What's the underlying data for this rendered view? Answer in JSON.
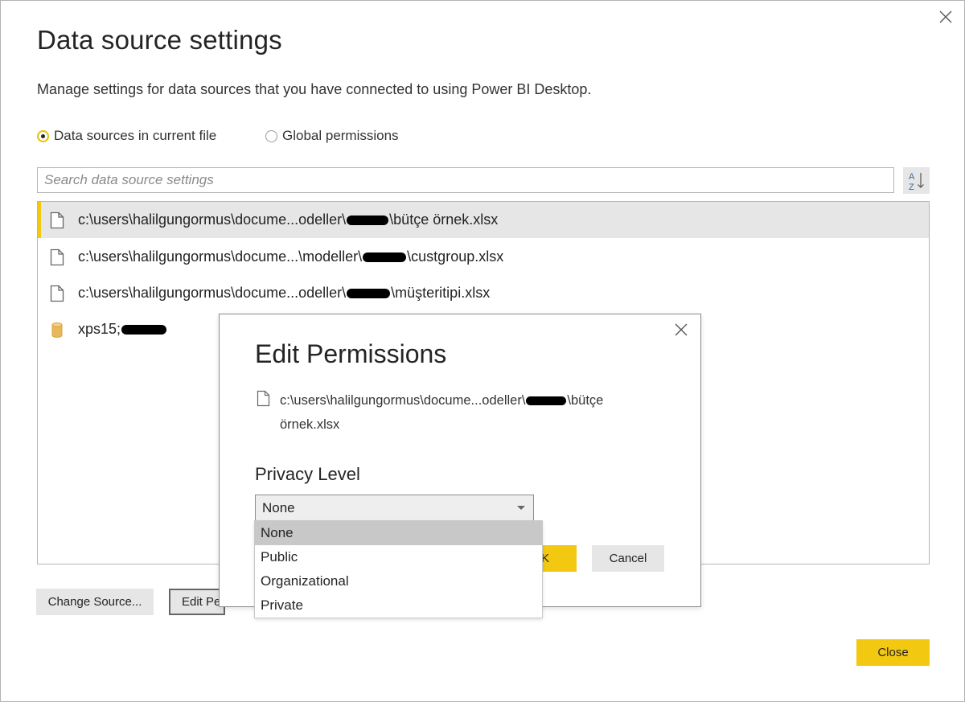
{
  "window": {
    "title": "Data source settings",
    "subtitle": "Manage settings for data sources that you have connected to using Power BI Desktop.",
    "close_icon": "close-icon"
  },
  "scope": {
    "current_file_label": "Data sources in current file",
    "current_file_selected": true,
    "global_label": "Global permissions",
    "global_selected": false
  },
  "search": {
    "placeholder": "Search data source settings",
    "value": "",
    "sort_icon": "sort-az-icon"
  },
  "sources": [
    {
      "icon": "file-icon",
      "prefix": "c:\\users\\halilgungormus\\docume...odeller\\",
      "suffix": "\\bütçe örnek.xlsx",
      "selected": true
    },
    {
      "icon": "file-icon",
      "prefix": "c:\\users\\halilgungormus\\docume...\\modeller\\",
      "suffix": "\\custgroup.xlsx",
      "selected": false
    },
    {
      "icon": "file-icon",
      "prefix": "c:\\users\\halilgungormus\\docume...odeller\\",
      "suffix": "\\müşteritipi.xlsx",
      "selected": false
    },
    {
      "icon": "database-icon",
      "prefix": "xps15;",
      "suffix": "",
      "selected": false
    }
  ],
  "actions": {
    "change_source": "Change Source...",
    "edit_permissions": "Edit Pe",
    "close": "Close"
  },
  "dialog": {
    "title": "Edit Permissions",
    "path_prefix": "c:\\users\\halilgungormus\\docume...odeller\\",
    "path_mid": "\\bütçe",
    "path_line2": "örnek.xlsx",
    "privacy_label": "Privacy Level",
    "selected": "None",
    "options": [
      "None",
      "Public",
      "Organizational",
      "Private"
    ],
    "ok_label": "K",
    "cancel_label": "Cancel"
  },
  "colors": {
    "accent": "#f2c811",
    "selected_row": "#e6e6e6",
    "button_gray": "#e6e6e6",
    "text": "#252423"
  }
}
